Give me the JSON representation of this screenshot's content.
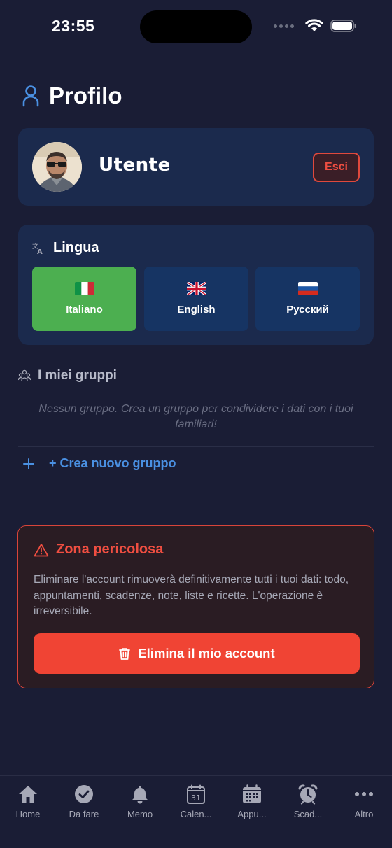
{
  "status": {
    "time": "23:55"
  },
  "header": {
    "title": "Profilo"
  },
  "user": {
    "name": "Utente",
    "logout_label": "Esci"
  },
  "language": {
    "title": "Lingua",
    "options": [
      {
        "label": "Italiano",
        "flag": "flag-it",
        "selected": true
      },
      {
        "label": "English",
        "flag": "flag-gb",
        "selected": false
      },
      {
        "label": "Русский",
        "flag": "flag-ru",
        "selected": false
      }
    ]
  },
  "groups": {
    "title": "I miei gruppi",
    "empty_text": "Nessun gruppo. Crea un gruppo per condividere i dati con i tuoi familiari!",
    "create_label": "+ Crea nuovo gruppo"
  },
  "danger_zone": {
    "title": "Zona pericolosa",
    "description": "Eliminare l'account rimuoverà definitivamente tutti i tuoi dati: todo, appuntamenti, scadenze, note, liste e ricette. L'operazione è irreversibile.",
    "delete_label": "Elimina il mio account"
  },
  "tabs": [
    {
      "label": "Home",
      "icon": "house-icon"
    },
    {
      "label": "Da fare",
      "icon": "checkmark-circle-icon"
    },
    {
      "label": "Memo",
      "icon": "bell-icon"
    },
    {
      "label": "Calen...",
      "icon": "calendar-31-icon",
      "day": "31"
    },
    {
      "label": "Appu...",
      "icon": "calendar-grid-icon"
    },
    {
      "label": "Scad...",
      "icon": "alarm-clock-icon"
    },
    {
      "label": "Altro",
      "icon": "ellipsis-icon"
    }
  ],
  "colors": {
    "background": "#1a1d35",
    "card": "#1b2a4d",
    "accent_blue": "#4a90e2",
    "selected_green": "#4caf50",
    "danger_red": "#f04434"
  }
}
